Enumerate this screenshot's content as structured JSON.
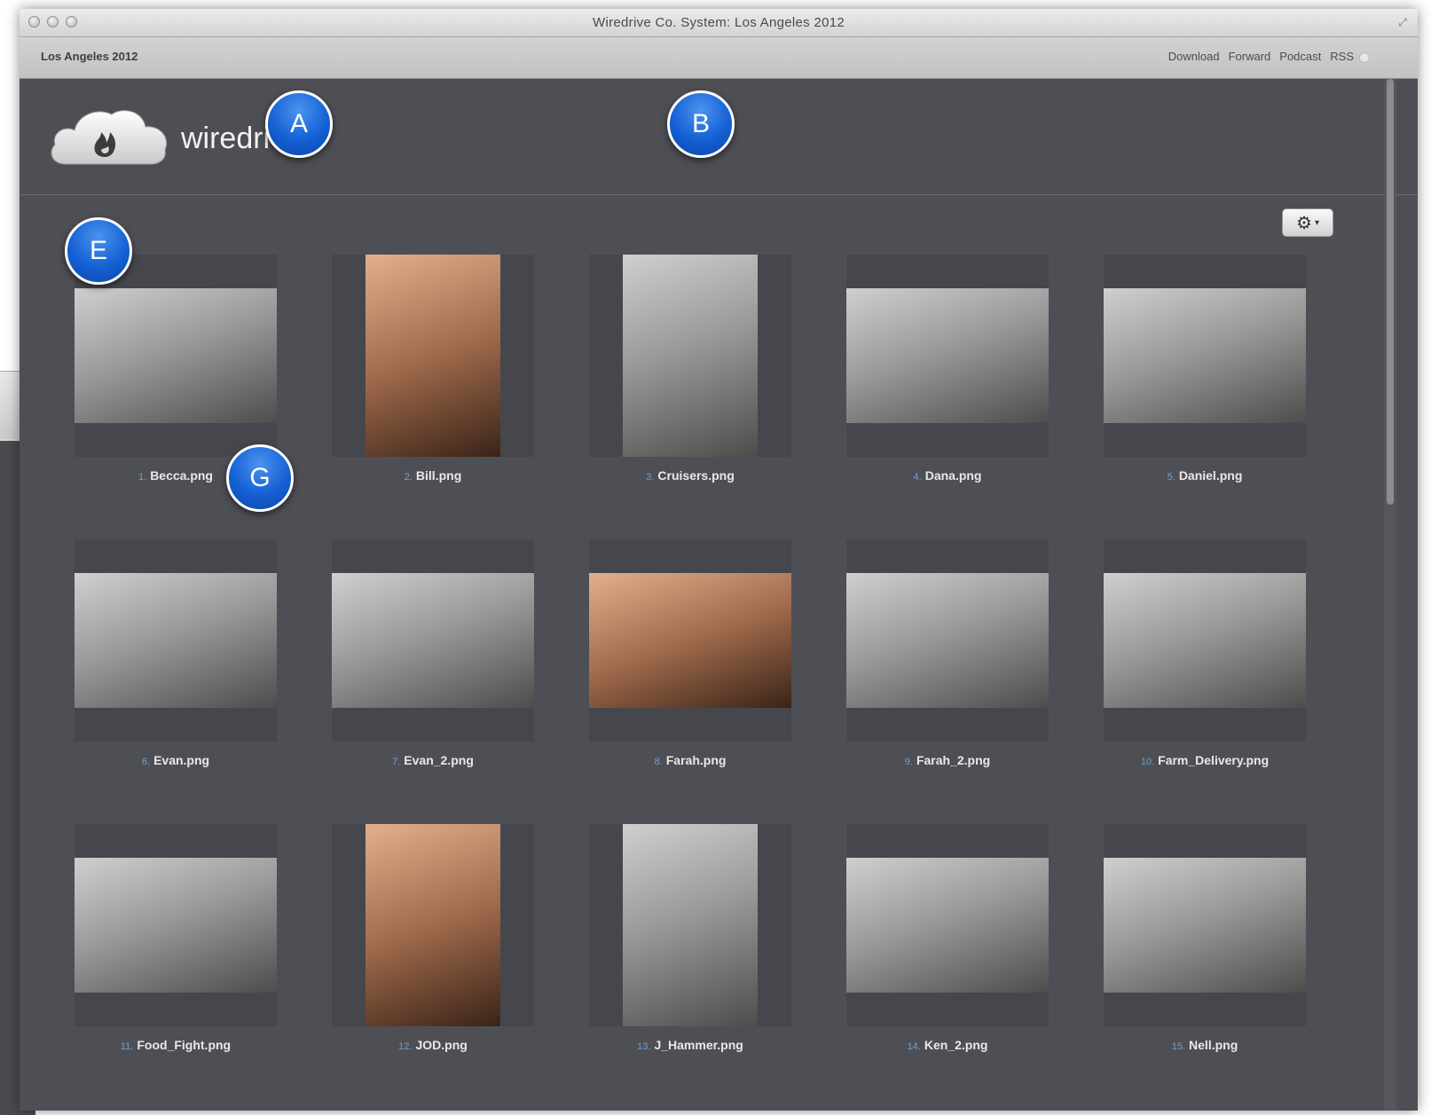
{
  "window": {
    "title": "Wiredrive Co. System: Los Angeles 2012"
  },
  "toolbar": {
    "title": "Los Angeles 2012",
    "links": [
      "Download",
      "Forward",
      "Podcast",
      "RSS"
    ]
  },
  "header": {
    "logo_text": "wiredrive"
  },
  "settings": {
    "gear_icon": "⚙",
    "caret_icon": "▾"
  },
  "files": [
    {
      "num": "1.",
      "name": "Becca.png",
      "tone": "gray",
      "shape": "landscape"
    },
    {
      "num": "2.",
      "name": "Bill.png",
      "tone": "warm",
      "shape": "portrait"
    },
    {
      "num": "3.",
      "name": "Cruisers.png",
      "tone": "gray",
      "shape": "portrait"
    },
    {
      "num": "4.",
      "name": "Dana.png",
      "tone": "gray",
      "shape": "landscape"
    },
    {
      "num": "5.",
      "name": "Daniel.png",
      "tone": "gray",
      "shape": "landscape"
    },
    {
      "num": "6.",
      "name": "Evan.png",
      "tone": "gray",
      "shape": "landscape"
    },
    {
      "num": "7.",
      "name": "Evan_2.png",
      "tone": "gray",
      "shape": "landscape"
    },
    {
      "num": "8.",
      "name": "Farah.png",
      "tone": "warm",
      "shape": "landscape"
    },
    {
      "num": "9.",
      "name": "Farah_2.png",
      "tone": "gray",
      "shape": "landscape"
    },
    {
      "num": "10.",
      "name": "Farm_Delivery.png",
      "tone": "gray",
      "shape": "landscape"
    },
    {
      "num": "11.",
      "name": "Food_Fight.png",
      "tone": "gray",
      "shape": "landscape"
    },
    {
      "num": "12.",
      "name": "JOD.png",
      "tone": "warm",
      "shape": "portrait"
    },
    {
      "num": "13.",
      "name": "J_Hammer.png",
      "tone": "gray",
      "shape": "portrait"
    },
    {
      "num": "14.",
      "name": "Ken_2.png",
      "tone": "gray",
      "shape": "landscape"
    },
    {
      "num": "15.",
      "name": "Nell.png",
      "tone": "gray",
      "shape": "landscape"
    }
  ],
  "markers": {
    "A": "A",
    "B": "B",
    "E": "E",
    "G": "G"
  }
}
